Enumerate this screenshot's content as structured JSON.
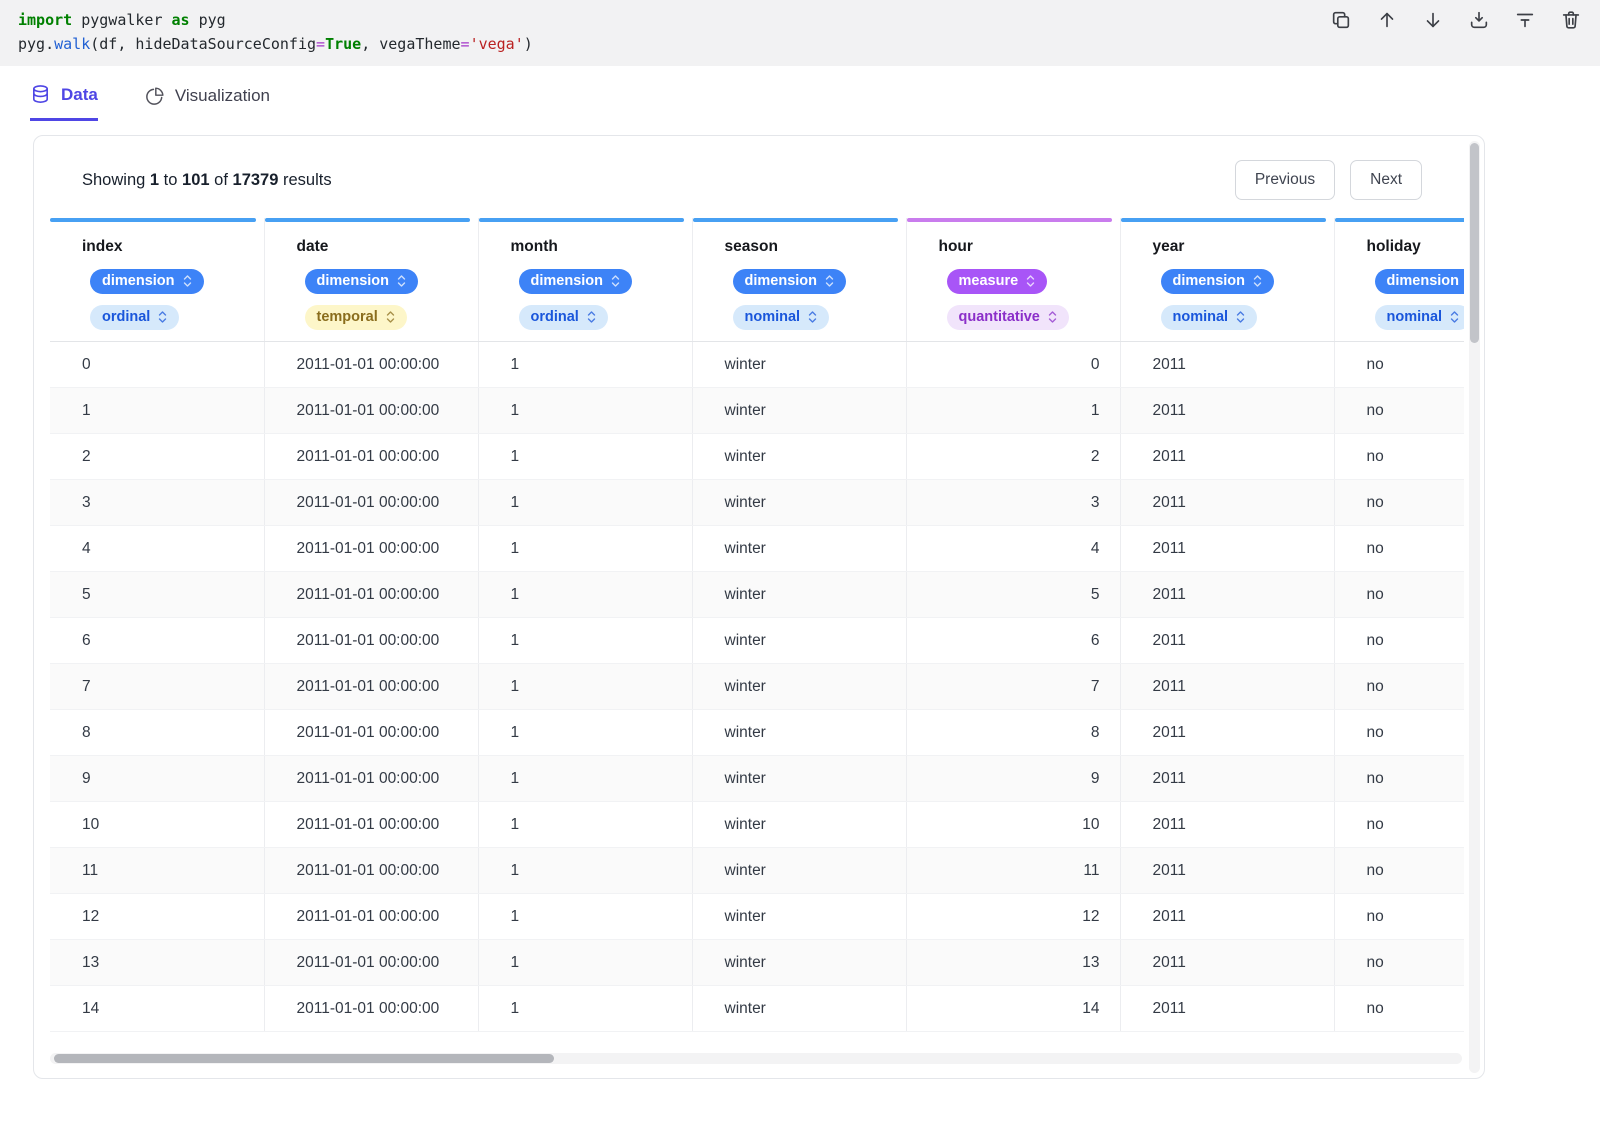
{
  "code": {
    "lines": [
      [
        {
          "text": "import",
          "cls": "kw"
        },
        {
          "text": " pygwalker ",
          "cls": "plain"
        },
        {
          "text": "as",
          "cls": "kw"
        },
        {
          "text": " pyg",
          "cls": "plain"
        }
      ],
      [
        {
          "text": "pyg.",
          "cls": "plain"
        },
        {
          "text": "walk",
          "cls": "fn"
        },
        {
          "text": "(df, hideDataSourceConfig",
          "cls": "plain"
        },
        {
          "text": "=",
          "cls": "op"
        },
        {
          "text": "True",
          "cls": "bool"
        },
        {
          "text": ", vegaTheme",
          "cls": "plain"
        },
        {
          "text": "=",
          "cls": "op"
        },
        {
          "text": "'vega'",
          "cls": "str"
        },
        {
          "text": ")",
          "cls": "plain"
        }
      ]
    ],
    "toolbar_icons": [
      "copy-cell",
      "move-up",
      "move-down",
      "save-cell",
      "filter",
      "delete-cell"
    ]
  },
  "tabs": [
    {
      "label": "Data",
      "icon": "database-icon",
      "active": true
    },
    {
      "label": "Visualization",
      "icon": "pie-chart-icon",
      "active": false
    }
  ],
  "results": {
    "showing": "Showing",
    "from": "1",
    "to_word": "to",
    "to": "101",
    "of_word": "of",
    "total": "17379",
    "results_word": "results"
  },
  "pagination": {
    "previous": "Previous",
    "next": "Next"
  },
  "table": {
    "columns": [
      {
        "name": "index",
        "role": "dimension",
        "type": "ordinal",
        "accent": "#47a0f3",
        "align": "left"
      },
      {
        "name": "date",
        "role": "dimension",
        "type": "temporal",
        "accent": "#47a0f3",
        "align": "left"
      },
      {
        "name": "month",
        "role": "dimension",
        "type": "ordinal",
        "accent": "#47a0f3",
        "align": "left"
      },
      {
        "name": "season",
        "role": "dimension",
        "type": "nominal",
        "accent": "#47a0f3",
        "align": "left"
      },
      {
        "name": "hour",
        "role": "measure",
        "type": "quantitative",
        "accent": "#c97ced",
        "align": "right"
      },
      {
        "name": "year",
        "role": "dimension",
        "type": "nominal",
        "accent": "#47a0f3",
        "align": "left"
      },
      {
        "name": "holiday",
        "role": "dimension",
        "type": "nominal",
        "accent": "#47a0f3",
        "align": "left"
      }
    ],
    "pill_colors": {
      "dimension": {
        "bg": "#3d83f7",
        "fg": "#ffffff"
      },
      "measure": {
        "bg": "#a855f7",
        "fg": "#ffffff"
      },
      "ordinal": {
        "bg": "#d6e9fb",
        "fg": "#1a56db"
      },
      "temporal": {
        "bg": "#fdf6c9",
        "fg": "#8a6d1d"
      },
      "nominal": {
        "bg": "#d6e9fb",
        "fg": "#1a56db"
      },
      "quantitative": {
        "bg": "#f1e4fb",
        "fg": "#8b2fc9"
      }
    },
    "rows": [
      [
        "0",
        "2011-01-01 00:00:00",
        "1",
        "winter",
        "0",
        "2011",
        "no"
      ],
      [
        "1",
        "2011-01-01 00:00:00",
        "1",
        "winter",
        "1",
        "2011",
        "no"
      ],
      [
        "2",
        "2011-01-01 00:00:00",
        "1",
        "winter",
        "2",
        "2011",
        "no"
      ],
      [
        "3",
        "2011-01-01 00:00:00",
        "1",
        "winter",
        "3",
        "2011",
        "no"
      ],
      [
        "4",
        "2011-01-01 00:00:00",
        "1",
        "winter",
        "4",
        "2011",
        "no"
      ],
      [
        "5",
        "2011-01-01 00:00:00",
        "1",
        "winter",
        "5",
        "2011",
        "no"
      ],
      [
        "6",
        "2011-01-01 00:00:00",
        "1",
        "winter",
        "6",
        "2011",
        "no"
      ],
      [
        "7",
        "2011-01-01 00:00:00",
        "1",
        "winter",
        "7",
        "2011",
        "no"
      ],
      [
        "8",
        "2011-01-01 00:00:00",
        "1",
        "winter",
        "8",
        "2011",
        "no"
      ],
      [
        "9",
        "2011-01-01 00:00:00",
        "1",
        "winter",
        "9",
        "2011",
        "no"
      ],
      [
        "10",
        "2011-01-01 00:00:00",
        "1",
        "winter",
        "10",
        "2011",
        "no"
      ],
      [
        "11",
        "2011-01-01 00:00:00",
        "1",
        "winter",
        "11",
        "2011",
        "no"
      ],
      [
        "12",
        "2011-01-01 00:00:00",
        "1",
        "winter",
        "12",
        "2011",
        "no"
      ],
      [
        "13",
        "2011-01-01 00:00:00",
        "1",
        "winter",
        "13",
        "2011",
        "no"
      ],
      [
        "14",
        "2011-01-01 00:00:00",
        "1",
        "winter",
        "14",
        "2011",
        "no"
      ]
    ]
  }
}
